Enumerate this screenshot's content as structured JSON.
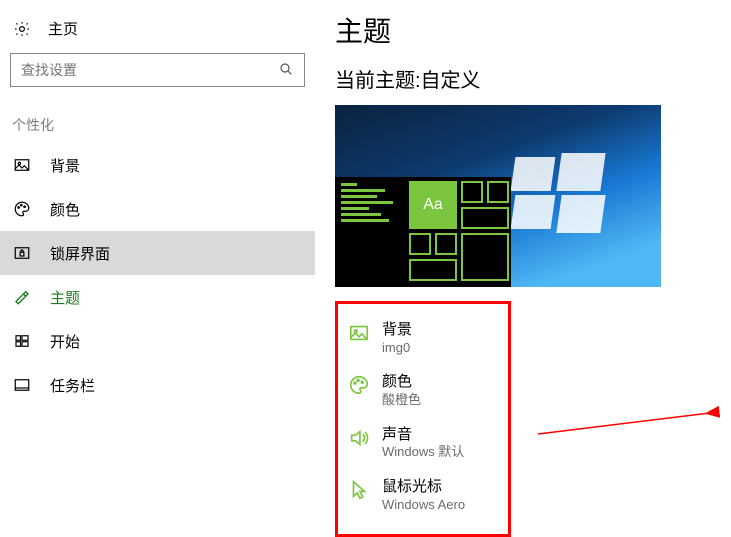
{
  "sidebar": {
    "home_label": "主页",
    "search_placeholder": "查找设置",
    "category_label": "个性化",
    "items": [
      {
        "label": "背景"
      },
      {
        "label": "颜色"
      },
      {
        "label": "锁屏界面"
      },
      {
        "label": "主题"
      },
      {
        "label": "开始"
      },
      {
        "label": "任务栏"
      }
    ]
  },
  "main": {
    "title": "主题",
    "current_theme_label": "当前主题:自定义",
    "preview_tile_text": "Aa",
    "options": [
      {
        "title": "背景",
        "sub": "img0"
      },
      {
        "title": "颜色",
        "sub": "酸橙色"
      },
      {
        "title": "声音",
        "sub": "Windows 默认"
      },
      {
        "title": "鼠标光标",
        "sub": "Windows Aero"
      }
    ]
  }
}
